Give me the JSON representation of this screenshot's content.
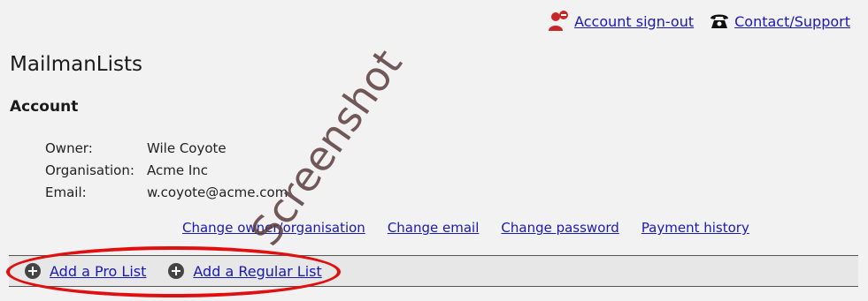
{
  "header": {
    "signout_label": "Account sign-out",
    "contact_label": "Contact/Support",
    "signout_icon": "user-remove-icon",
    "contact_icon": "telephone-icon"
  },
  "app": {
    "title": "MailmanLists"
  },
  "account": {
    "section_title": "Account",
    "fields": [
      {
        "label": "Owner:",
        "value": "Wile Coyote"
      },
      {
        "label": "Organisation:",
        "value": "Acme Inc"
      },
      {
        "label": "Email:",
        "value": "w.coyote@acme.com"
      }
    ]
  },
  "actions": {
    "change_owner": "Change owner/organisation",
    "change_email": "Change email",
    "change_password": "Change password",
    "payment_history": "Payment history"
  },
  "lists": {
    "add_pro": "Add a Pro List",
    "add_regular": "Add a Regular List",
    "add_icon": "plus-circle-icon"
  },
  "watermark": {
    "text": "Screenshot"
  },
  "colors": {
    "link": "#1a1ab0",
    "highlight": "#e01010",
    "background": "#f2f2f2",
    "signout_icon": "#c62828"
  }
}
